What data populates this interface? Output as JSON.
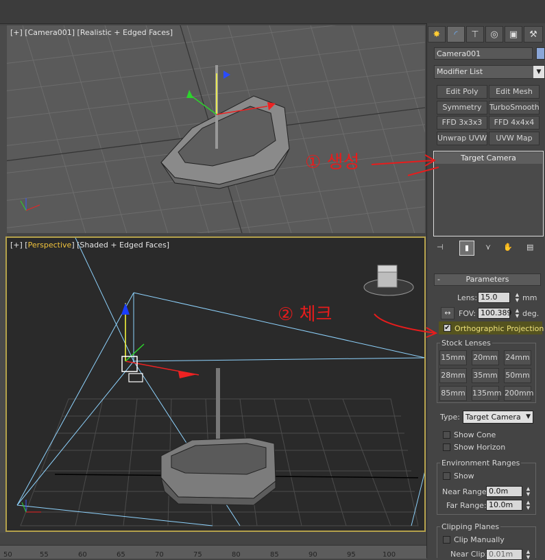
{
  "viewports": {
    "top": {
      "label_open": "[+] [Camera001] [Realistic + Edged Faces]"
    },
    "perspective": {
      "label_bracket_open": "[+] [",
      "label_view": "Perspective",
      "label_rest": "] [Shaded + Edged Faces]"
    }
  },
  "panel": {
    "tabs": [
      "create-icon",
      "modify-icon",
      "hierarchy-icon",
      "motion-icon",
      "display-icon",
      "utilities-icon"
    ],
    "object_name": "Camera001",
    "modifier_list": "Modifier List",
    "modifier_buttons": [
      "Edit Poly",
      "Edit Mesh",
      "Symmetry",
      "TurboSmooth",
      "FFD 3x3x3",
      "FFD 4x4x4",
      "Unwrap UVW",
      "UVW Map"
    ],
    "stack_item": "Target Camera",
    "parameters": {
      "title": "Parameters",
      "lens_label": "Lens:",
      "lens_value": "15.0",
      "lens_unit": "mm",
      "fov_label": "FOV:",
      "fov_value": "100.389",
      "fov_unit": "deg.",
      "ortho_label": "Orthographic Projection",
      "ortho_checked": true,
      "stock_lenses_label": "Stock Lenses",
      "stock_lenses": [
        "15mm",
        "20mm",
        "24mm",
        "28mm",
        "35mm",
        "50mm",
        "85mm",
        "135mm",
        "200mm"
      ],
      "type_label": "Type:",
      "type_value": "Target Camera",
      "show_cone": "Show Cone",
      "show_horizon": "Show Horizon",
      "env_ranges_label": "Environment Ranges",
      "show": "Show",
      "near_range_label": "Near Range:",
      "near_range_value": "0.0m",
      "far_range_label": "Far Range:",
      "far_range_value": "10.0m",
      "clipping_label": "Clipping Planes",
      "clip_manually": "Clip Manually",
      "near_clip_label": "Near Clip:",
      "near_clip_value": "0.01m"
    }
  },
  "annotations": {
    "step1": "① 생성",
    "step2": "② 체크"
  },
  "timeline": {
    "ticks": [
      "50",
      "55",
      "60",
      "65",
      "70",
      "75",
      "80",
      "85",
      "90",
      "95",
      "100"
    ]
  }
}
